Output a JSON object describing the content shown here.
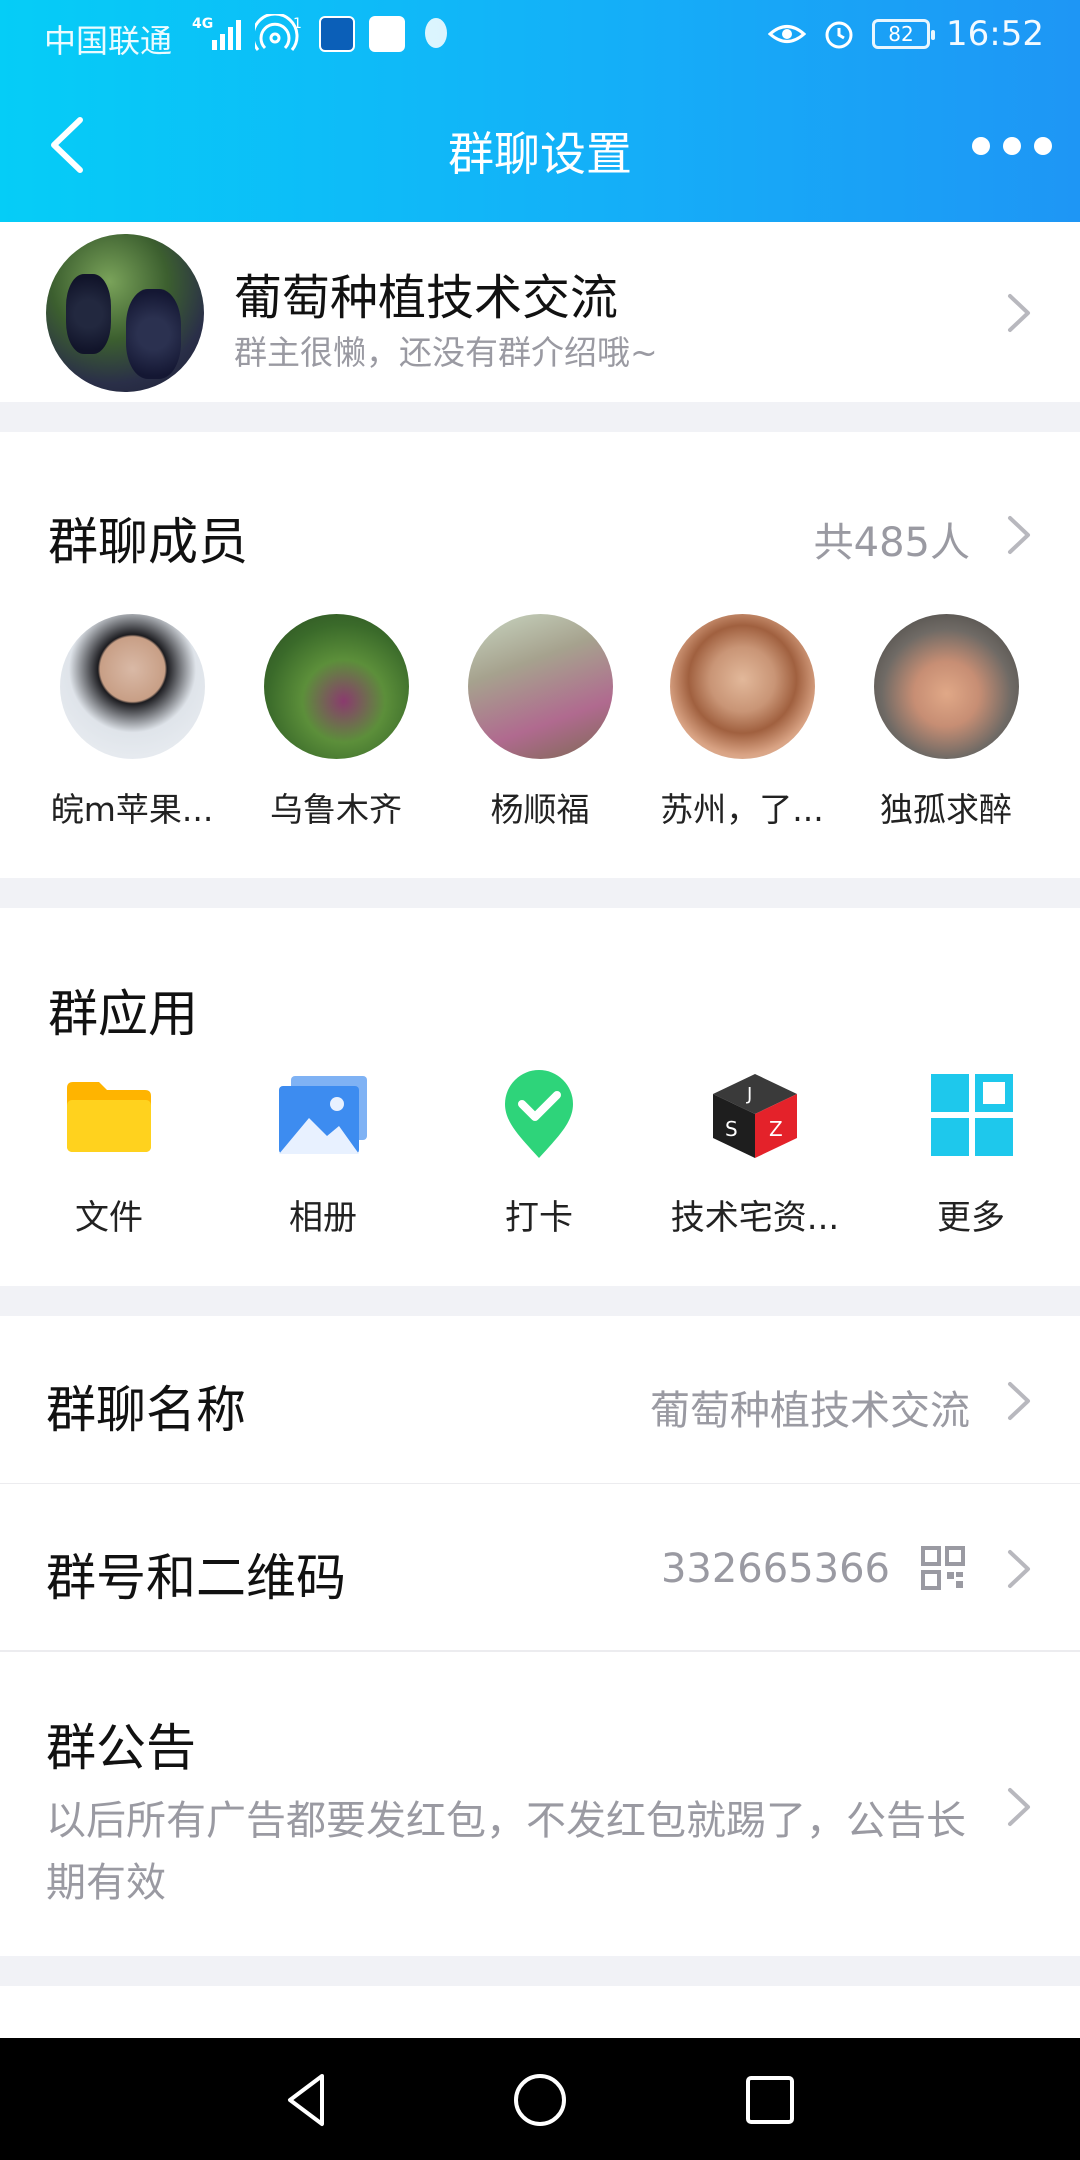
{
  "status_bar": {
    "carrier": "中国联通",
    "network": "4G",
    "hotspot_count": "1",
    "battery": "82",
    "time": "16:52"
  },
  "nav": {
    "title": "群聊设置",
    "back_icon": "back-arrow-icon",
    "more_icon": "more-dots-icon"
  },
  "group": {
    "name": "葡萄种植技术交流",
    "intro": "群主很懒，还没有群介绍哦~"
  },
  "members": {
    "title": "群聊成员",
    "count": "共485人",
    "list": [
      {
        "name": "皖m苹果..."
      },
      {
        "name": "乌鲁木齐"
      },
      {
        "name": "杨顺福"
      },
      {
        "name": "苏州，了..."
      },
      {
        "name": "独孤求醉"
      }
    ]
  },
  "apps": {
    "title": "群应用",
    "items": [
      {
        "label": "文件",
        "icon": "folder-icon"
      },
      {
        "label": "相册",
        "icon": "album-icon"
      },
      {
        "label": "打卡",
        "icon": "checkin-icon"
      },
      {
        "label": "技术宅资...",
        "icon": "jsz-cube-icon"
      },
      {
        "label": "更多",
        "icon": "more-grid-icon"
      }
    ]
  },
  "settings": {
    "name_label": "群聊名称",
    "name_value": "葡萄种植技术交流",
    "qr_label": "群号和二维码",
    "qr_value": "332665366",
    "notice_label": "群公告",
    "notice_text": "以后所有广告都要发红包，不发红包就踢了，公告长期有效"
  },
  "colors": {
    "header_start": "#05cdf7",
    "header_end": "#1e96f5",
    "background": "#f1f2f6",
    "secondary_text": "#9a9aa2"
  }
}
